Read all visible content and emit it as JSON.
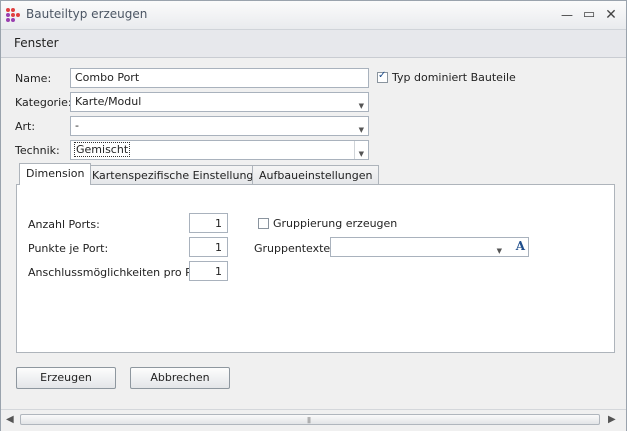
{
  "window": {
    "title": "Bauteiltyp erzeugen"
  },
  "menu": {
    "item": "Fenster"
  },
  "form": {
    "name_label": "Name:",
    "name_value": "Combo Port",
    "dominates_label": "Typ dominiert Bauteile",
    "dominates_checked": true,
    "category_label": "Kategorie:",
    "category_value": "Karte/Modul",
    "kind_label": "Art:",
    "kind_value": "-",
    "tech_label": "Technik:",
    "tech_value": "Gemischt"
  },
  "tabs": [
    {
      "label": "Dimension",
      "active": true
    },
    {
      "label": "Kartenspezifische Einstellungen",
      "active": false
    },
    {
      "label": "Aufbaueinstellungen",
      "active": false
    }
  ],
  "dimension": {
    "ports_label": "Anzahl Ports:",
    "ports_value": "1",
    "points_label": "Punkte je Port:",
    "points_value": "1",
    "connections_label": "Anschlussmöglichkeiten pro Port:",
    "connections_value": "1",
    "grouping_label": "Gruppierung erzeugen",
    "grouping_checked": false,
    "grouptexts_label": "Gruppentexte:",
    "grouptexts_value": ""
  },
  "buttons": {
    "create": "Erzeugen",
    "cancel": "Abbrechen"
  },
  "icons": {
    "app": "app-dots-icon",
    "minimize": "minimize-icon",
    "maximize": "maximize-icon",
    "close": "close-icon",
    "font": "font-style-icon"
  },
  "colors": {
    "accent": "#1f4e8c",
    "window_bg": "#f0f0f0",
    "titlebar": "#e9ebee"
  }
}
